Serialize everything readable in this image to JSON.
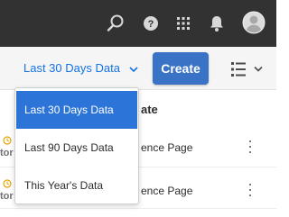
{
  "shell": {
    "icons": [
      "search-icon",
      "help-icon",
      "apps-grid-icon",
      "notifications-bell-icon",
      "user-avatar"
    ]
  },
  "actionbar": {
    "date_range_label": "Last 30 Days Data",
    "create_label": "Create"
  },
  "table": {
    "column_header": "ate",
    "rows": [
      {
        "left_text": "tor",
        "title": "ence Page"
      },
      {
        "left_text": "tor",
        "title": "ence Page"
      }
    ]
  },
  "dropdown": {
    "options": [
      {
        "label": "Last 30 Days Data",
        "selected": true
      },
      {
        "label": "Last 90 Days Data",
        "selected": false
      },
      {
        "label": "This Year's Data",
        "selected": false
      }
    ]
  },
  "colors": {
    "shell_bg": "#323232",
    "accent": "#1473e6",
    "create_bg": "#3a73c5",
    "selected_bg": "#2d74d8",
    "status_icon": "#e3a400"
  }
}
